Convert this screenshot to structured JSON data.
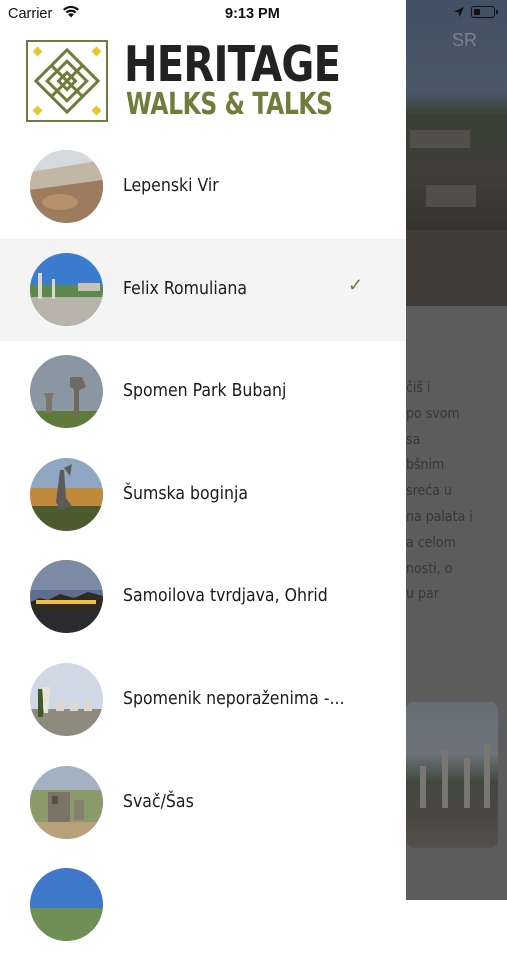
{
  "status_bar": {
    "carrier": "Carrier",
    "time": "9:13 PM",
    "battery_level": 0.35
  },
  "brand": {
    "line1": "HERITAGE",
    "line2": "WALKS & TALKS"
  },
  "drawer": {
    "items": [
      {
        "label": "Lepenski Vir",
        "selected": false,
        "icon": "photo-lepenski-vir"
      },
      {
        "label": "Felix Romuliana",
        "selected": true,
        "icon": "photo-felix-romuliana"
      },
      {
        "label": "Spomen Park Bubanj",
        "selected": false,
        "icon": "photo-spomen-park-bubanj"
      },
      {
        "label": "Šumska boginja",
        "selected": false,
        "icon": "photo-sumska-boginja"
      },
      {
        "label": "Samoilova tvrdjava, Ohrid",
        "selected": false,
        "icon": "photo-samoilova-tvrdjava"
      },
      {
        "label": "Spomenik neporaženima -...",
        "selected": false,
        "icon": "photo-spomenik-neporazenima"
      },
      {
        "label": "Svač/Šas",
        "selected": false,
        "icon": "photo-svac-sas"
      },
      {
        "label": "",
        "selected": false,
        "icon": "photo-partial"
      }
    ],
    "check_glyph": "✓"
  },
  "background": {
    "language_button": "SR",
    "text_lines": [
      "čiš i",
      "po svom",
      "sa",
      "bšnim",
      "sreća u",
      "na palata i",
      "a celom",
      "nosti, o",
      "u par"
    ]
  },
  "colors": {
    "accent": "#6f7d3a",
    "selected_row": "#f4f4f4",
    "overlay": "rgba(0,0,0,0.4)"
  }
}
